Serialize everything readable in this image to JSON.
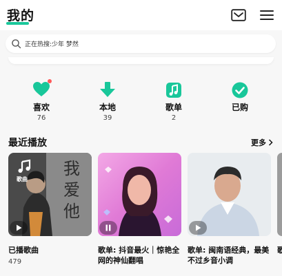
{
  "header": {
    "title": "我的"
  },
  "search": {
    "placeholder": "正在热搜:少年 梦然"
  },
  "shortcuts": [
    {
      "label": "喜欢",
      "count": "76",
      "icon": "heart-icon"
    },
    {
      "label": "本地",
      "count": "39",
      "icon": "download-icon"
    },
    {
      "label": "歌单",
      "count": "2",
      "icon": "music-note-icon"
    },
    {
      "label": "已购",
      "count": "",
      "icon": "check-circle-icon"
    }
  ],
  "recent": {
    "title": "最近播放",
    "more_label": "更多",
    "cards": [
      {
        "badge": "歌曲",
        "cover_text": "我 爱 他",
        "title": "已播歌曲",
        "sub": "479"
      },
      {
        "title": "歌单: 抖音最火｜惊艳全网的神仙翻唱",
        "sub": ""
      },
      {
        "title": "歌单: 闽南语经典，最美不过乡音小调",
        "sub": ""
      },
      {
        "title": "歌",
        "sub": ""
      }
    ]
  },
  "colors": {
    "accent": "#19c79a",
    "dot": "#ff5a5a"
  }
}
